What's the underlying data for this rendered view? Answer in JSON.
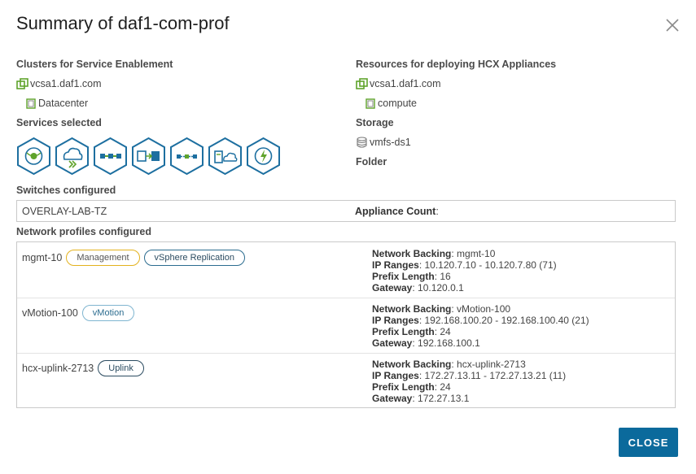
{
  "dialog": {
    "title": "Summary of daf1-com-prof",
    "close_label": "CLOSE"
  },
  "clusters": {
    "heading": "Clusters for Service Enablement",
    "vcenter": "vcsa1.daf1.com",
    "datacenter": "Datacenter"
  },
  "resources": {
    "heading": "Resources for deploying HCX Appliances",
    "vcenter": "vcsa1.daf1.com",
    "cluster": "compute"
  },
  "storage": {
    "heading": "Storage",
    "datastore": "vmfs-ds1"
  },
  "folder": {
    "heading": "Folder"
  },
  "services": {
    "heading": "Services selected",
    "icons": [
      "interconnect-icon",
      "wan-optimization-icon",
      "network-extension-icon",
      "bulk-migration-icon",
      "vmotion-migration-icon",
      "disaster-recovery-icon",
      "sentinel-icon"
    ],
    "accent": "#1d6fa0"
  },
  "switches": {
    "heading": "Switches configured",
    "value": "OVERLAY-LAB-TZ",
    "appliance_count_label": "Appliance Count",
    "appliance_count_sep": ":"
  },
  "network_profiles": {
    "heading": "Network profiles configured",
    "labels": {
      "backing": "Network Backing",
      "ip_ranges": "IP Ranges",
      "prefix": "Prefix Length",
      "gateway": "Gateway"
    },
    "rows": [
      {
        "name": "mgmt-10",
        "badges": [
          "Management",
          "vSphere Replication"
        ],
        "backing": "mgmt-10",
        "ip_ranges": "10.120.7.10 - 10.120.7.80 (71)",
        "prefix": "16",
        "gateway": "10.120.0.1"
      },
      {
        "name": "vMotion-100",
        "badges": [
          "vMotion"
        ],
        "backing": "vMotion-100",
        "ip_ranges": "192.168.100.20 - 192.168.100.40 (21)",
        "prefix": "24",
        "gateway": "192.168.100.1"
      },
      {
        "name": "hcx-uplink-2713",
        "badges": [
          "Uplink"
        ],
        "backing": "hcx-uplink-2713",
        "ip_ranges": "172.27.13.11 - 172.27.13.21 (11)",
        "prefix": "24",
        "gateway": "172.27.13.1"
      }
    ]
  }
}
